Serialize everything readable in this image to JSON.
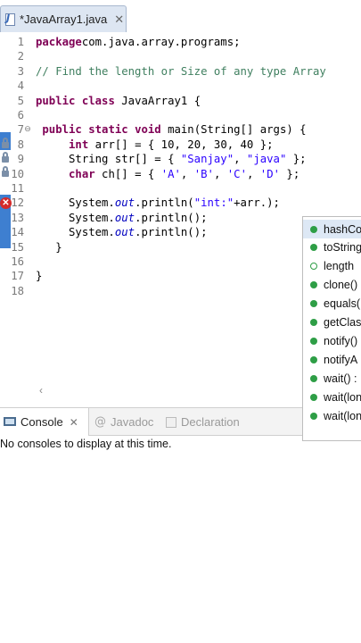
{
  "editor_tab": {
    "title": "*JavaArray1.java",
    "close": "✕"
  },
  "lines": [
    {
      "n": "1",
      "parts": [
        [
          "kw",
          "package"
        ],
        [
          "",
          "com.java.array.programs;"
        ]
      ]
    },
    {
      "n": "2",
      "parts": []
    },
    {
      "n": "3",
      "parts": [
        [
          "cm",
          "// Find the length or Size of any type Array"
        ]
      ]
    },
    {
      "n": "4",
      "parts": []
    },
    {
      "n": "5",
      "parts": [
        [
          "kw",
          "public"
        ],
        [
          "",
          " "
        ],
        [
          "kw",
          "class"
        ],
        [
          "",
          " JavaArray1 {"
        ]
      ]
    },
    {
      "n": "6",
      "parts": []
    },
    {
      "n": "7",
      "parts": [
        [
          "",
          " "
        ],
        [
          "kw",
          "public"
        ],
        [
          "",
          " "
        ],
        [
          "kw",
          "static"
        ],
        [
          "",
          " "
        ],
        [
          "kw",
          "void"
        ],
        [
          "",
          " main(String[] args) {"
        ]
      ]
    },
    {
      "n": "8",
      "parts": [
        [
          "",
          "     "
        ],
        [
          "kw",
          "int"
        ],
        [
          "",
          " arr[] = { 10, 20, 30, 40 };"
        ]
      ]
    },
    {
      "n": "9",
      "parts": [
        [
          "",
          "     String str[] = { "
        ],
        [
          "st",
          "\"Sanjay\""
        ],
        [
          "",
          ", "
        ],
        [
          "st",
          "\"java\""
        ],
        [
          "",
          " };"
        ]
      ]
    },
    {
      "n": "10",
      "parts": [
        [
          "",
          "     "
        ],
        [
          "kw",
          "char"
        ],
        [
          "",
          " ch[] = { "
        ],
        [
          "st",
          "'A'"
        ],
        [
          "",
          ", "
        ],
        [
          "st",
          "'B'"
        ],
        [
          "",
          ", "
        ],
        [
          "st",
          "'C'"
        ],
        [
          "",
          ", "
        ],
        [
          "st",
          "'D'"
        ],
        [
          "",
          " };"
        ]
      ]
    },
    {
      "n": "11",
      "parts": []
    },
    {
      "n": "12",
      "parts": [
        [
          "",
          "     System."
        ],
        [
          "fld",
          "out"
        ],
        [
          "",
          ".println("
        ],
        [
          "st",
          "\"int:\""
        ],
        [
          "",
          "+arr.);"
        ]
      ]
    },
    {
      "n": "13",
      "parts": [
        [
          "",
          "     System."
        ],
        [
          "fld",
          "out"
        ],
        [
          "",
          ".println();"
        ]
      ]
    },
    {
      "n": "14",
      "parts": [
        [
          "",
          "     System."
        ],
        [
          "fld",
          "out"
        ],
        [
          "",
          ".println();"
        ]
      ]
    },
    {
      "n": "15",
      "parts": [
        [
          "",
          "   }"
        ]
      ]
    },
    {
      "n": "16",
      "parts": []
    },
    {
      "n": "17",
      "parts": [
        [
          "",
          "}"
        ]
      ]
    },
    {
      "n": "18",
      "parts": []
    }
  ],
  "console": {
    "tabs": [
      {
        "label": "Console",
        "close": "✕"
      },
      {
        "label": "Javadoc"
      },
      {
        "label": "Declaration"
      }
    ],
    "message": "No consoles to display at this time."
  },
  "content_assist": {
    "items": [
      {
        "label": "hashCo",
        "kind": "method",
        "selected": true
      },
      {
        "label": "toString",
        "kind": "method"
      },
      {
        "label": "length",
        "kind": "field"
      },
      {
        "label": "clone()",
        "kind": "method"
      },
      {
        "label": "equals(",
        "kind": "method"
      },
      {
        "label": "getClas",
        "kind": "method"
      },
      {
        "label": "notify()",
        "kind": "method"
      },
      {
        "label": "notifyA",
        "kind": "method"
      },
      {
        "label": "wait() :",
        "kind": "method"
      },
      {
        "label": "wait(lon",
        "kind": "method"
      },
      {
        "label": "wait(lon",
        "kind": "method"
      }
    ]
  },
  "colors": {
    "keyword": "#7f0055",
    "comment": "#3f7f5f",
    "string": "#2a00ff",
    "field": "#0000c0",
    "error": "#d42b2b",
    "method_dot": "#2e9e46"
  }
}
